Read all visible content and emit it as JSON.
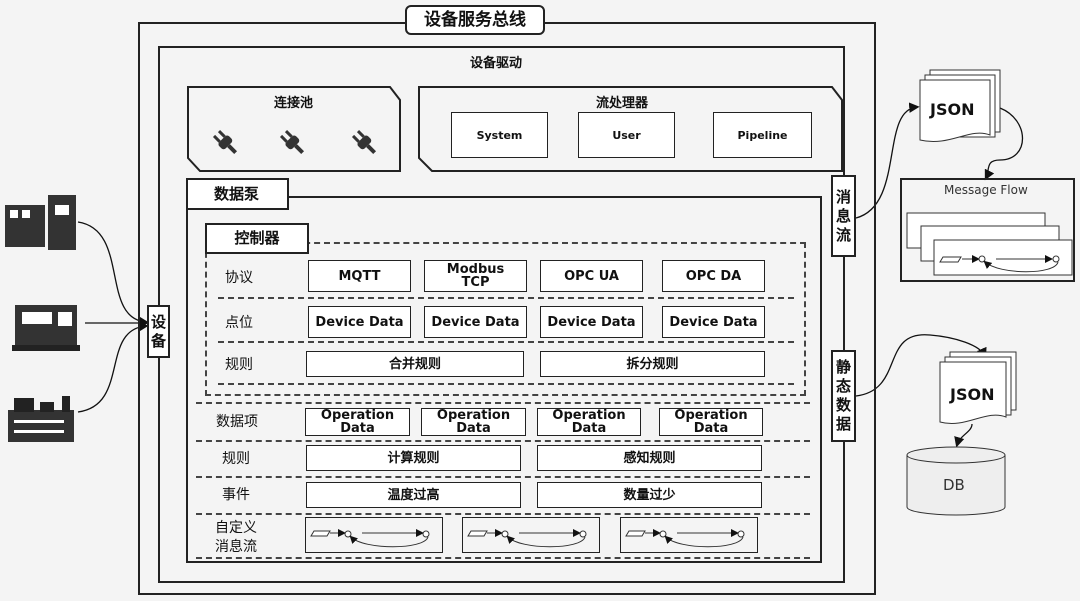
{
  "title": "设备服务总线",
  "driver": {
    "title": "设备驱动",
    "pool": {
      "title": "连接池",
      "icons": [
        "plug-icon",
        "plug-icon",
        "plug-icon"
      ]
    },
    "stream": {
      "title": "流处理器",
      "items": [
        "System",
        "User",
        "Pipeline"
      ]
    }
  },
  "pump": {
    "title": "数据泵",
    "controller": {
      "title": "控制器",
      "protocol": {
        "label": "协议",
        "items": [
          "MQTT",
          "Modbus TCP",
          "OPC UA",
          "OPC DA"
        ]
      },
      "points": {
        "label": "点位",
        "items": [
          "Device Data",
          "Device Data",
          "Device Data",
          "Device Data"
        ]
      },
      "rules": {
        "label": "规则",
        "items": [
          "合并规则",
          "拆分规则"
        ]
      }
    },
    "data_items": {
      "label": "数据项",
      "items": [
        "Operation Data",
        "Operation Data",
        "Operation Data",
        "Operation Data"
      ]
    },
    "rules": {
      "label": "规则",
      "items": [
        "计算规则",
        "感知规则"
      ]
    },
    "events": {
      "label": "事件",
      "items": [
        "温度过高",
        "数量过少"
      ]
    },
    "custom": {
      "label_1": "自定义",
      "label_2": "消息流"
    }
  },
  "device_tag": [
    "设",
    "备"
  ],
  "message_tag": [
    "消",
    "息",
    "流"
  ],
  "static_tag": [
    "静",
    "态",
    "数",
    "据"
  ],
  "json_1": "JSON",
  "message_flow": "Message Flow",
  "json_2": "JSON",
  "db": "DB"
}
